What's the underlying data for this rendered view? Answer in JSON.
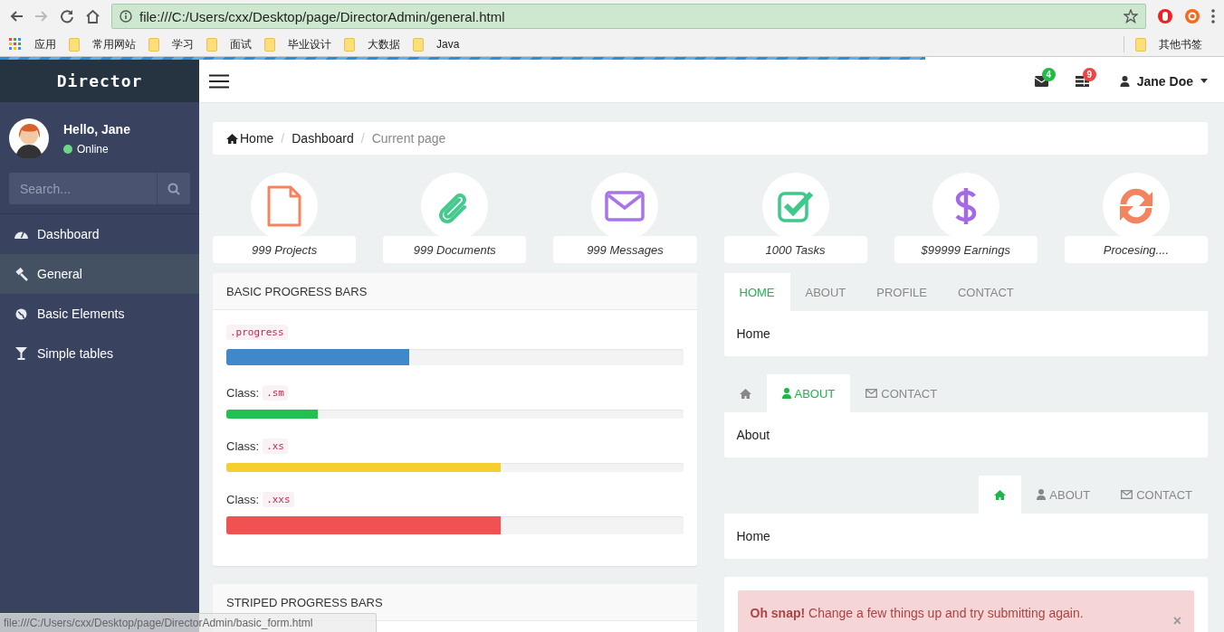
{
  "browser": {
    "address": "file:///C:/Users/cxx/Desktop/page/DirectorAdmin/general.html",
    "bookmarks": [
      {
        "kind": "apps",
        "label": "应用"
      },
      {
        "kind": "folder",
        "label": "常用网站"
      },
      {
        "kind": "folder",
        "label": "学习"
      },
      {
        "kind": "folder",
        "label": "面试"
      },
      {
        "kind": "folder",
        "label": "毕业设计"
      },
      {
        "kind": "folder",
        "label": "大数据"
      },
      {
        "kind": "folder",
        "label": "Java"
      }
    ],
    "other_bookmarks": "其他书签"
  },
  "page_loading": {
    "level": 0.756
  },
  "sidebar": {
    "brand": "Director",
    "greeting": "Hello, Jane",
    "status": "Online",
    "search": {
      "placeholder": "Search..."
    },
    "items": [
      {
        "kind": "dashboard",
        "label": "Dashboard",
        "selected": false
      },
      {
        "kind": "gavel",
        "label": "General",
        "selected": true
      },
      {
        "kind": "globe",
        "label": "Basic Elements",
        "selected": false
      },
      {
        "kind": "glass",
        "label": "Simple tables",
        "selected": false
      }
    ]
  },
  "topbar": {
    "notifications": [
      {
        "kind": "mail",
        "count": "4",
        "color": "#22bb44"
      },
      {
        "kind": "list",
        "count": "9",
        "color": "#ee4444"
      }
    ],
    "user": "Jane Doe"
  },
  "breadcrumb": [
    {
      "kind": "home",
      "label": "Home",
      "current": false
    },
    {
      "kind": "text",
      "separator": "/",
      "label": "Dashboard",
      "current": false
    },
    {
      "kind": "text",
      "separator": "/",
      "label": "Current page",
      "current": true
    }
  ],
  "stats": [
    {
      "kind": "file",
      "color": "#f4845f",
      "label": "999 Projects"
    },
    {
      "kind": "paperclip",
      "color": "#45c98f",
      "label": "999 Documents"
    },
    {
      "kind": "envelope",
      "color": "#a974e8",
      "label": "999 Messages"
    },
    {
      "kind": "check",
      "color": "#3dc98a",
      "label": "1000 Tasks"
    },
    {
      "kind": "dollar",
      "color": "#a369e8",
      "label": "$99999 Earnings"
    },
    {
      "kind": "sync",
      "color": "#f4845f",
      "label": "Procesing...."
    }
  ],
  "progress_panel": {
    "title": "BASIC PROGRESS BARS",
    "bars": [
      {
        "kind": "md",
        "code": ".progress",
        "color": "#3f88c9",
        "level": 0.4
      },
      {
        "kind": "sm",
        "label": "Class:",
        "code": ".sm",
        "color": "#22c04f",
        "level": 0.2
      },
      {
        "kind": "xs",
        "label": "Class:",
        "code": ".xs",
        "color": "#f5cf2f",
        "level": 0.6
      },
      {
        "kind": "xxs",
        "label": "Class:",
        "code": ".xxs",
        "color": "#f05252",
        "level": 0.6
      }
    ]
  },
  "striped_panel": {
    "title": "STRIPED PROGRESS BARS"
  },
  "tab_panels": [
    {
      "kind": "left",
      "tabs": [
        {
          "kind": "text",
          "label": "HOME",
          "selected": true
        },
        {
          "kind": "text",
          "label": "ABOUT",
          "selected": false
        },
        {
          "kind": "text",
          "label": "PROFILE",
          "selected": false
        },
        {
          "kind": "text",
          "label": "CONTACT",
          "selected": false
        }
      ],
      "content": "Home"
    },
    {
      "kind": "left",
      "tabs": [
        {
          "kind": "home",
          "selected": false
        },
        {
          "kind": "user",
          "label": "ABOUT",
          "selected": true
        },
        {
          "kind": "envelope",
          "label": "CONTACT",
          "selected": false
        }
      ],
      "content": "About"
    },
    {
      "kind": "right",
      "tabs": [
        {
          "kind": "home",
          "selected": true
        },
        {
          "kind": "user",
          "label": "ABOUT",
          "selected": false
        },
        {
          "kind": "envelope",
          "label": "CONTACT",
          "selected": false
        }
      ],
      "content": "Home"
    }
  ],
  "alert": {
    "text": "**Oh snap!** Change a few things up and try submitting again.",
    "close": "×"
  },
  "status_tip": "file:///C:/Users/cxx/Desktop/page/DirectorAdmin/basic_form.html"
}
